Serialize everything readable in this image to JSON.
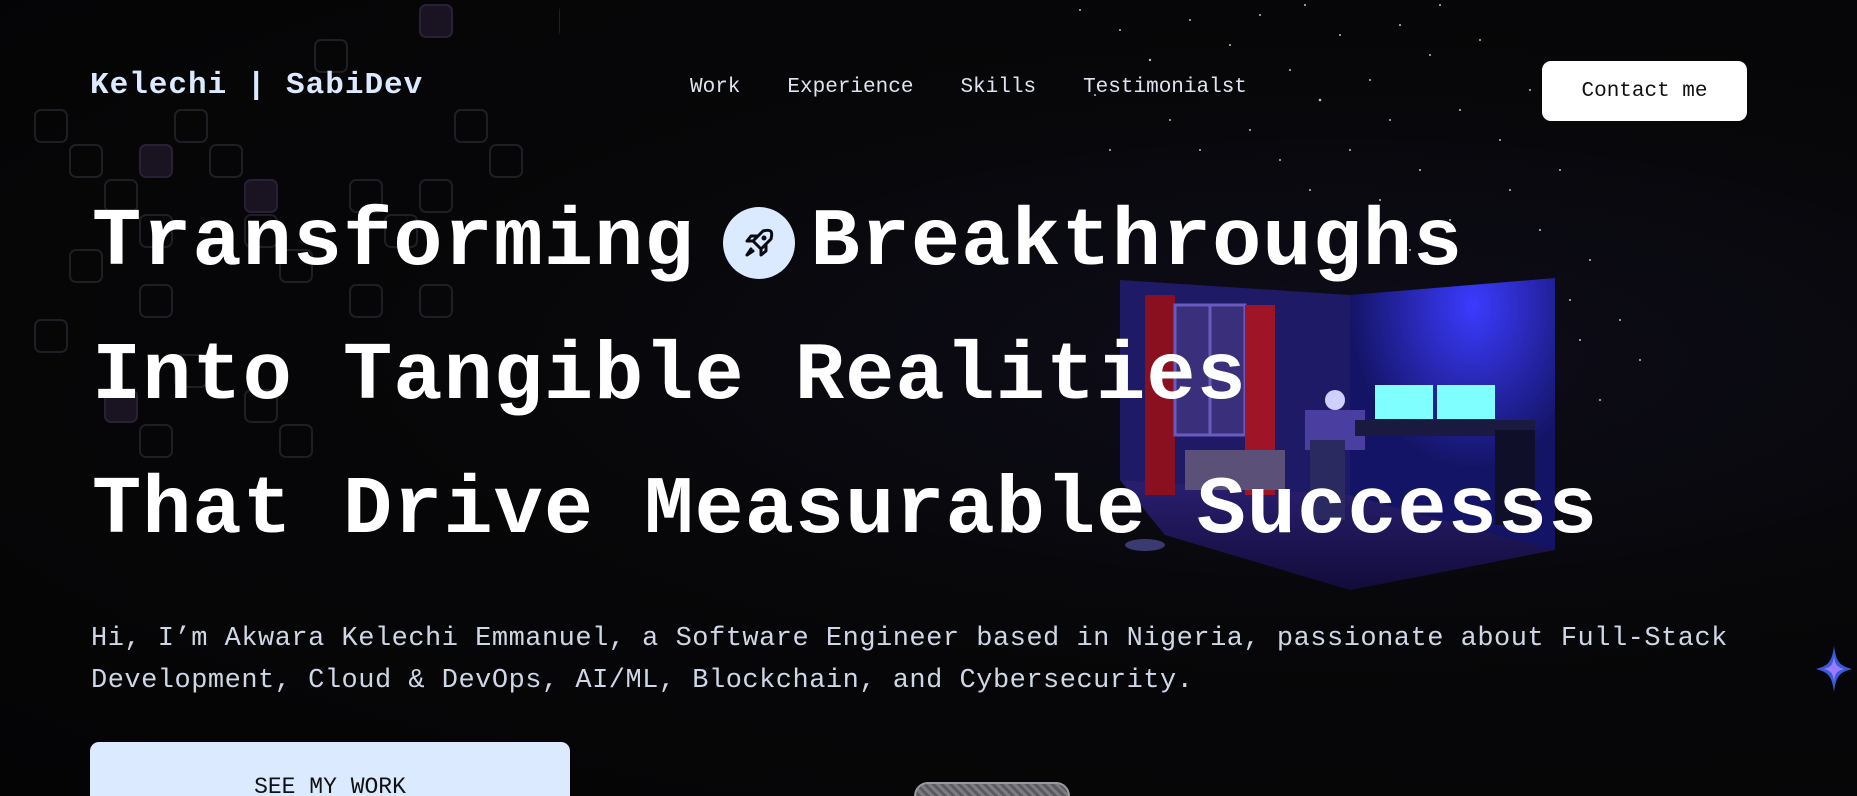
{
  "header": {
    "brand": "Kelechi | SabiDev",
    "nav": [
      "Work",
      "Experience",
      "Skills",
      "Testimonialst"
    ],
    "contact_label": "Contact me"
  },
  "hero": {
    "line1_a": "Transforming",
    "line1_b": "Breakthroughs",
    "line2": "Into Tangible Realities",
    "line3": "That Drive Measurable Successs",
    "badge_icon": "rocket-icon",
    "intro": "Hi, I’m Akwara Kelechi Emmanuel, a Software Engineer based in Nigeria, passionate about Full-Stack Development, Cloud & DevOps, AI/ML, Blockchain, and Cybersecurity.",
    "cta_label": "SEE MY WORK"
  },
  "colors": {
    "background": "#050507",
    "accent": "#dbeafe",
    "text": "#ffffff"
  }
}
